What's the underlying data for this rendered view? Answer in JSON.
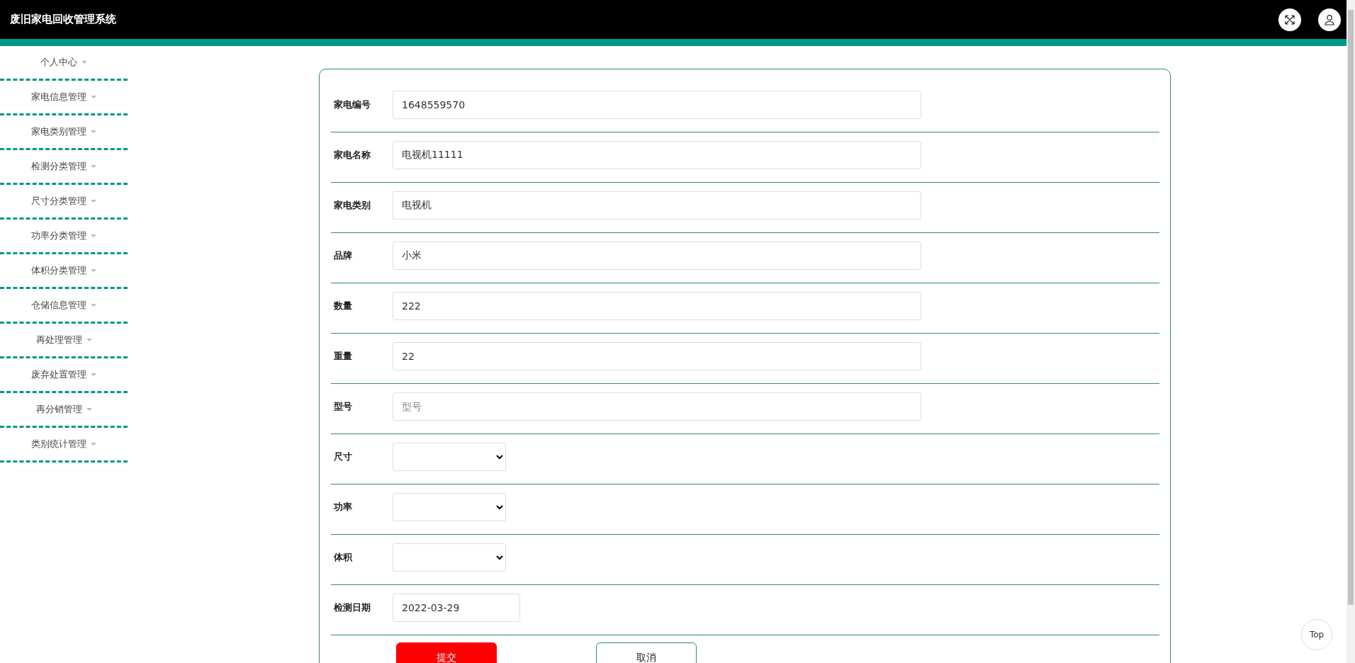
{
  "header": {
    "title": "废旧家电回收管理系统"
  },
  "sidebar": {
    "items": [
      {
        "label": "个人中心"
      },
      {
        "label": "家电信息管理"
      },
      {
        "label": "家电类别管理"
      },
      {
        "label": "检测分类管理"
      },
      {
        "label": "尺寸分类管理"
      },
      {
        "label": "功率分类管理"
      },
      {
        "label": "体积分类管理"
      },
      {
        "label": "仓储信息管理"
      },
      {
        "label": "再处理管理"
      },
      {
        "label": "废弃处置管理"
      },
      {
        "label": "再分销管理"
      },
      {
        "label": "类别统计管理"
      }
    ]
  },
  "form": {
    "fields": [
      {
        "label": "家电编号",
        "kind": "text",
        "value": "1648559570"
      },
      {
        "label": "家电名称",
        "kind": "text",
        "value": "电视机11111"
      },
      {
        "label": "家电类别",
        "kind": "text",
        "value": "电视机"
      },
      {
        "label": "品牌",
        "kind": "text",
        "value": "小米"
      },
      {
        "label": "数量",
        "kind": "text",
        "value": "222"
      },
      {
        "label": "重量",
        "kind": "text",
        "value": "22"
      },
      {
        "label": "型号",
        "kind": "text",
        "placeholder": "型号"
      },
      {
        "label": "尺寸",
        "kind": "select"
      },
      {
        "label": "功率",
        "kind": "select"
      },
      {
        "label": "体积",
        "kind": "select"
      },
      {
        "label": "检测日期",
        "kind": "date",
        "value": "2022-03-29"
      }
    ],
    "buttons": [
      {
        "label": "提交",
        "kind": "primary"
      },
      {
        "label": "取消",
        "kind": "secondary"
      }
    ]
  },
  "back_to_top": "Top"
}
